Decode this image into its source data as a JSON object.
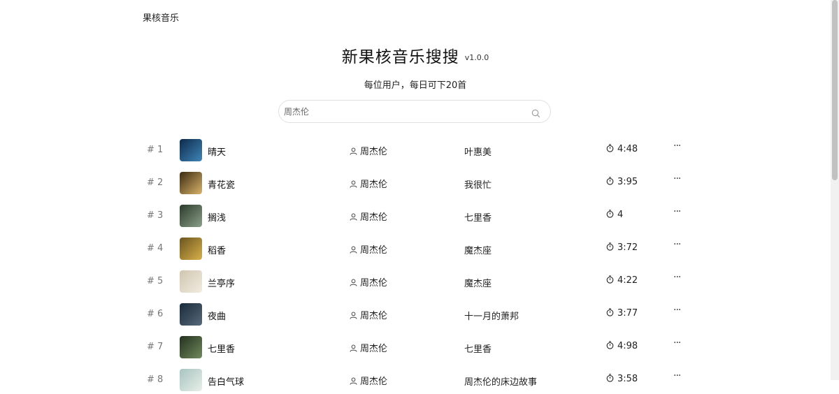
{
  "brand": "果核音乐",
  "header": {
    "title": "新果核音乐搜搜",
    "version": "v1.0.0",
    "subtitle": "每位用户，每日可下20首"
  },
  "search": {
    "value": "",
    "placeholder": "周杰伦"
  },
  "songs": [
    {
      "index": "# 1",
      "title": "晴天",
      "artist": "周杰伦",
      "album": "叶惠美",
      "duration": "4:48",
      "more": "···",
      "cover": [
        "#0d2a4a",
        "#3f85b8"
      ]
    },
    {
      "index": "# 2",
      "title": "青花瓷",
      "artist": "周杰伦",
      "album": "我很忙",
      "duration": "3:95",
      "more": "···",
      "cover": [
        "#3a2a12",
        "#d9b36a"
      ]
    },
    {
      "index": "# 3",
      "title": "搁浅",
      "artist": "周杰伦",
      "album": "七里香",
      "duration": "4",
      "more": "···",
      "cover": [
        "#2b3a2a",
        "#8aa08a"
      ]
    },
    {
      "index": "# 4",
      "title": "稻香",
      "artist": "周杰伦",
      "album": "魔杰座",
      "duration": "3:72",
      "more": "···",
      "cover": [
        "#6a5420",
        "#d9b04a"
      ]
    },
    {
      "index": "# 5",
      "title": "兰亭序",
      "artist": "周杰伦",
      "album": "魔杰座",
      "duration": "4:22",
      "more": "···",
      "cover": [
        "#cfc5b0",
        "#f2ece0"
      ]
    },
    {
      "index": "# 6",
      "title": "夜曲",
      "artist": "周杰伦",
      "album": "十一月的萧邦",
      "duration": "3:77",
      "more": "···",
      "cover": [
        "#1a2a3a",
        "#56697a"
      ]
    },
    {
      "index": "# 7",
      "title": "七里香",
      "artist": "周杰伦",
      "album": "七里香",
      "duration": "4:98",
      "more": "···",
      "cover": [
        "#243020",
        "#6f8a5c"
      ]
    },
    {
      "index": "# 8",
      "title": "告白气球",
      "artist": "周杰伦",
      "album": "周杰伦的床边故事",
      "duration": "3:58",
      "more": "···",
      "cover": [
        "#a8c4c0",
        "#e8efe8"
      ]
    }
  ]
}
